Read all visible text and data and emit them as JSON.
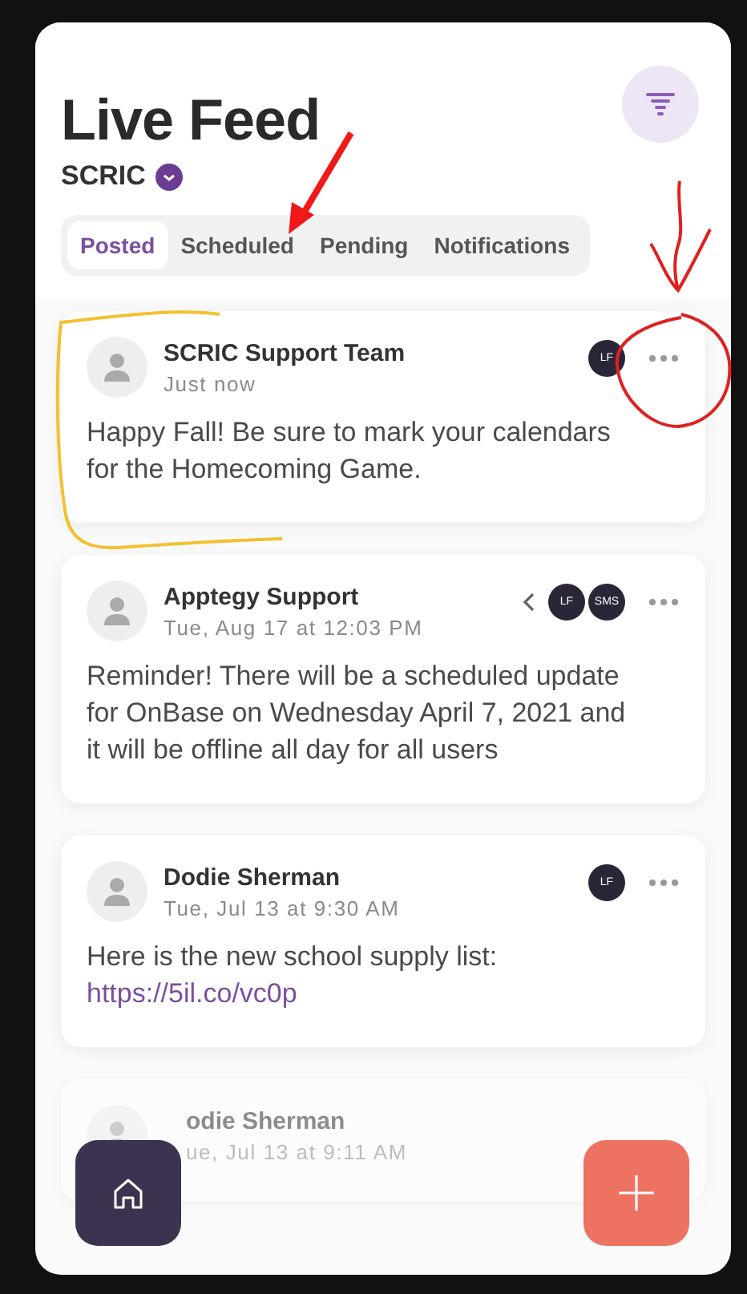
{
  "header": {
    "title": "Live Feed",
    "organization": "SCRIC"
  },
  "tabs": [
    {
      "label": "Posted",
      "selected": true
    },
    {
      "label": "Scheduled",
      "selected": false
    },
    {
      "label": "Pending",
      "selected": false
    },
    {
      "label": "Notifications",
      "selected": false
    }
  ],
  "posts": [
    {
      "author": "SCRIC Support Team",
      "time": "Just now",
      "body": "Happy Fall! Be sure to mark your calendars for the Homecoming Game.",
      "channels": [
        "LF"
      ],
      "collapse_toggle": false,
      "faded": false
    },
    {
      "author": "Apptegy Support",
      "time": "Tue, Aug 17 at 12:03 PM",
      "body": "Reminder! There will be a scheduled update for OnBase on Wednesday April 7, 2021 and it will be offline all day for all users",
      "channels": [
        "LF",
        "SMS"
      ],
      "collapse_toggle": true,
      "faded": false
    },
    {
      "author": "Dodie Sherman",
      "time": "Tue, Jul 13 at 9:30 AM",
      "body": "Here is the new school supply list: ",
      "link": "https://5il.co/vc0p",
      "channels": [
        "LF"
      ],
      "collapse_toggle": false,
      "faded": false
    },
    {
      "author": "odie Sherman",
      "time": "ue, Jul 13 at 9:11 AM",
      "collapse_toggle": false,
      "faded": true
    }
  ]
}
